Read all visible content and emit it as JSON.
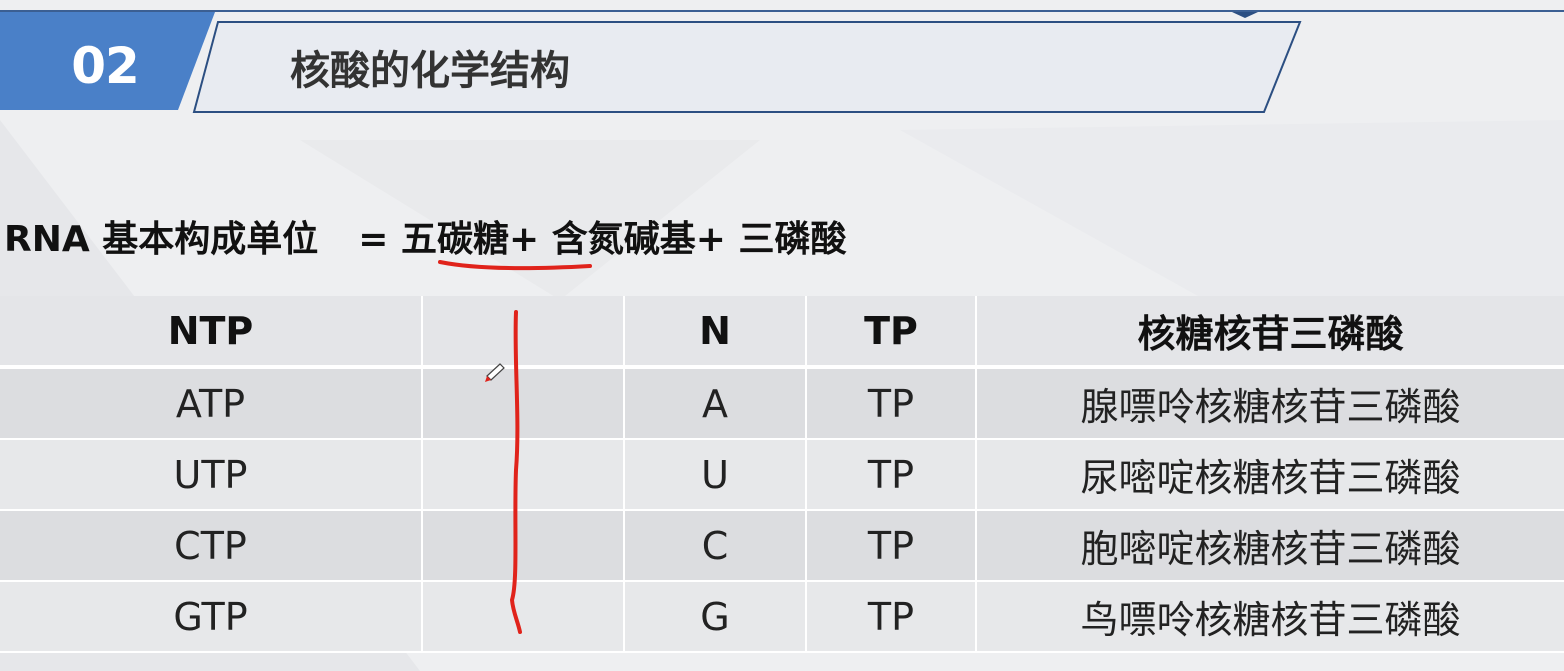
{
  "header": {
    "section_number": "02",
    "section_title": "核酸的化学结构"
  },
  "formula": {
    "subject": "RNA 基本构成单位",
    "equals": "=",
    "part1": "五碳糖",
    "plus1": "+",
    "part2": "含氮碱基",
    "plus2": "+",
    "part3": "三磷酸"
  },
  "table": {
    "headers": [
      "NTP",
      "",
      "N",
      "TP",
      "核糖核苷三磷酸"
    ],
    "rows": [
      [
        "ATP",
        "",
        "A",
        "TP",
        "腺嘌呤核糖核苷三磷酸"
      ],
      [
        "UTP",
        "",
        "U",
        "TP",
        "尿嘧啶核糖核苷三磷酸"
      ],
      [
        "CTP",
        "",
        "C",
        "TP",
        "胞嘧啶核糖核苷三磷酸"
      ],
      [
        "GTP",
        "",
        "G",
        "TP",
        "鸟嘌呤核糖核苷三磷酸"
      ]
    ]
  },
  "colors": {
    "accent_blue": "#4a80c8",
    "dark_blue": "#2c4f82",
    "annotation_red": "#e0231b",
    "row_odd": "#e7e8ea",
    "row_even": "#dcdde0"
  }
}
